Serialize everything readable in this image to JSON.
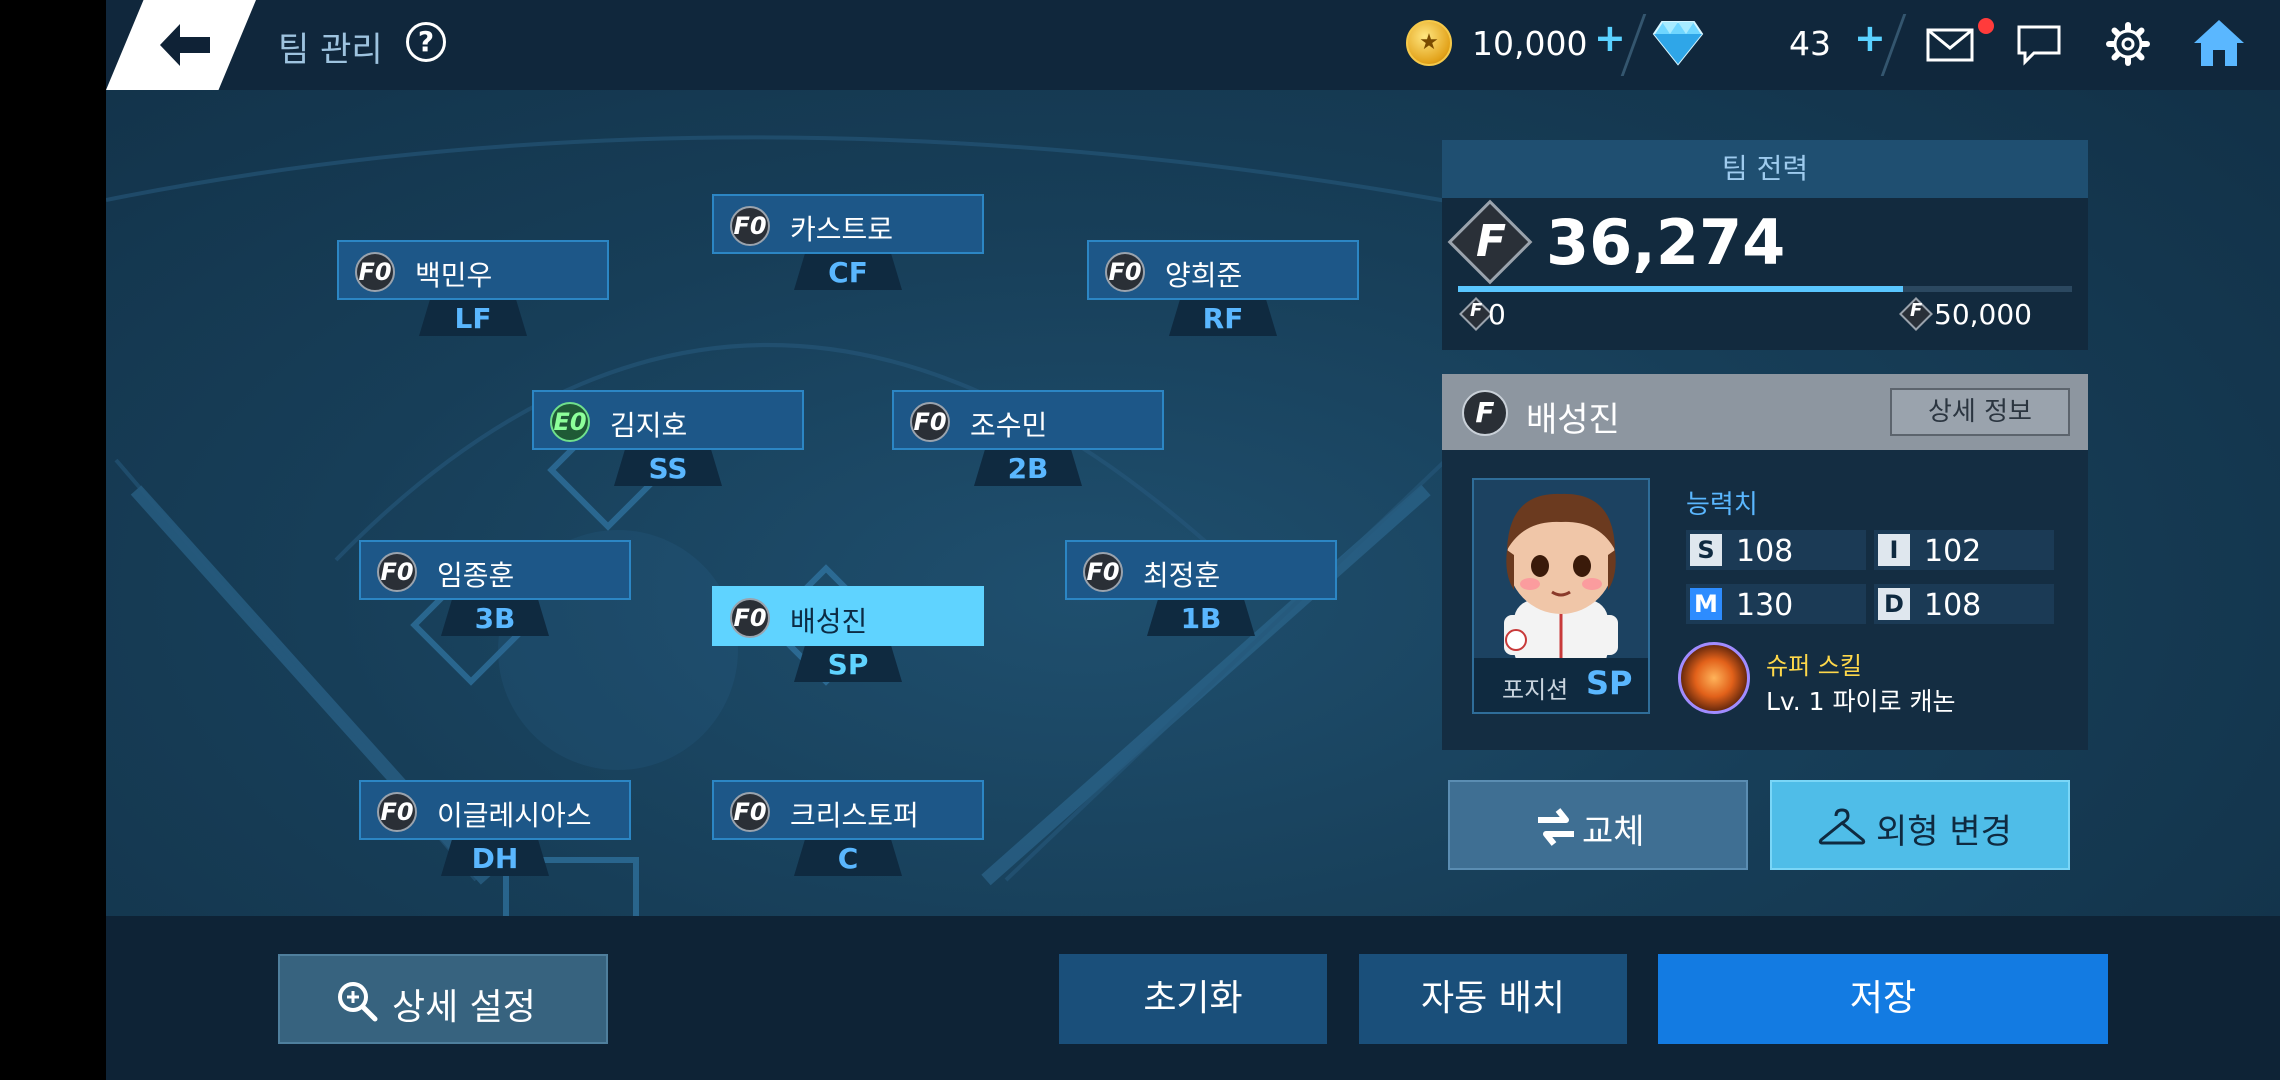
{
  "topbar": {
    "title": "팀 관리",
    "help_icon": "?",
    "coins": "10,000",
    "coins_plus": "+",
    "gems": "43",
    "gems_plus": "+"
  },
  "lineup": [
    {
      "name": "카스트로",
      "pos": "CF",
      "grade": "F0"
    },
    {
      "name": "백민우",
      "pos": "LF",
      "grade": "F0"
    },
    {
      "name": "양희준",
      "pos": "RF",
      "grade": "F0"
    },
    {
      "name": "김지호",
      "pos": "SS",
      "grade": "E0"
    },
    {
      "name": "조수민",
      "pos": "2B",
      "grade": "F0"
    },
    {
      "name": "임종훈",
      "pos": "3B",
      "grade": "F0"
    },
    {
      "name": "배성진",
      "pos": "SP",
      "grade": "F0"
    },
    {
      "name": "최정훈",
      "pos": "1B",
      "grade": "F0"
    },
    {
      "name": "이글레시아스",
      "pos": "DH",
      "grade": "F0"
    },
    {
      "name": "크리스토퍼",
      "pos": "C",
      "grade": "F0"
    }
  ],
  "team_power": {
    "title": "팀 전력",
    "value": "36,274",
    "min": "0",
    "max": "50,000",
    "fill_fraction": 0.7255
  },
  "selected_player": {
    "name": "배성진",
    "detail_button": "상세 정보",
    "position_label": "포지션",
    "position": "SP",
    "stats_title": "능력치",
    "stats": [
      {
        "key": "S",
        "value": "108"
      },
      {
        "key": "I",
        "value": "102"
      },
      {
        "key": "M",
        "value": "130"
      },
      {
        "key": "D",
        "value": "108"
      }
    ],
    "skill_title": "슈퍼 스킬",
    "skill_desc": "Lv. 1 파이로 캐논"
  },
  "actions": {
    "swap": "교체",
    "change_look": "외형 변경",
    "detail_setting": "상세 설정",
    "reset": "초기화",
    "auto_assign": "자동 배치",
    "save": "저장"
  },
  "colors": {
    "accent": "#5ab7ff",
    "selected": "#5fd3ff",
    "save": "#137be2",
    "notification": "#ff3b3b"
  }
}
